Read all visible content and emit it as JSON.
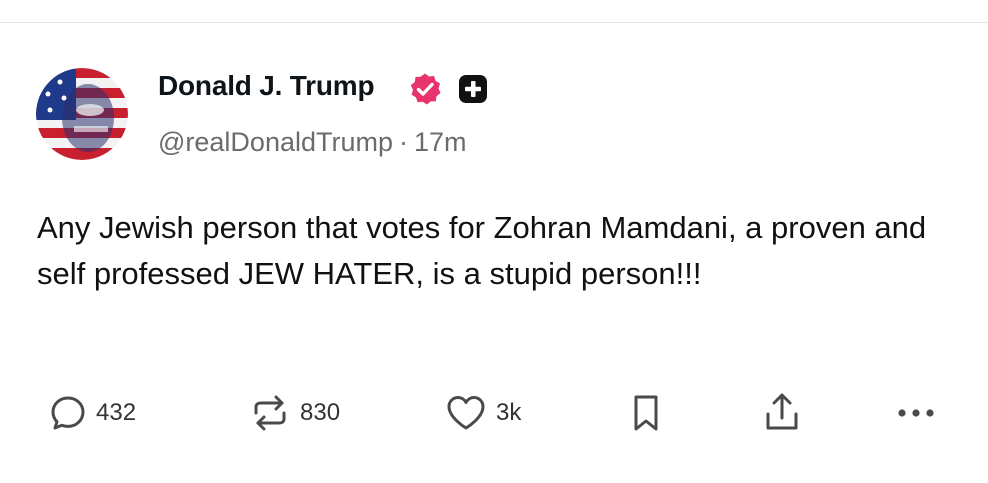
{
  "author": {
    "name": "Donald J. Trump",
    "handle": "@realDonaldTrump",
    "separator": "·",
    "time_ago": "17m"
  },
  "post": {
    "text": "Any Jewish person that votes for Zohran Mamdani, a proven and self professed JEW HATER, is a stupid person!!!"
  },
  "actions": {
    "reply_count": "432",
    "repost_count": "830",
    "like_count": "3k"
  },
  "icons": {
    "verified": "verified-badge-icon",
    "plus": "plus-badge-icon",
    "reply": "comment-bubble-icon",
    "repost": "repost-arrows-icon",
    "like": "heart-icon",
    "bookmark": "bookmark-icon",
    "share": "share-upload-icon",
    "more": "more-dots-icon"
  },
  "colors": {
    "verified_badge": "#e8336d",
    "text": "#111111",
    "secondary_text": "#6b6b6b",
    "icon": "#4a4a4a"
  }
}
